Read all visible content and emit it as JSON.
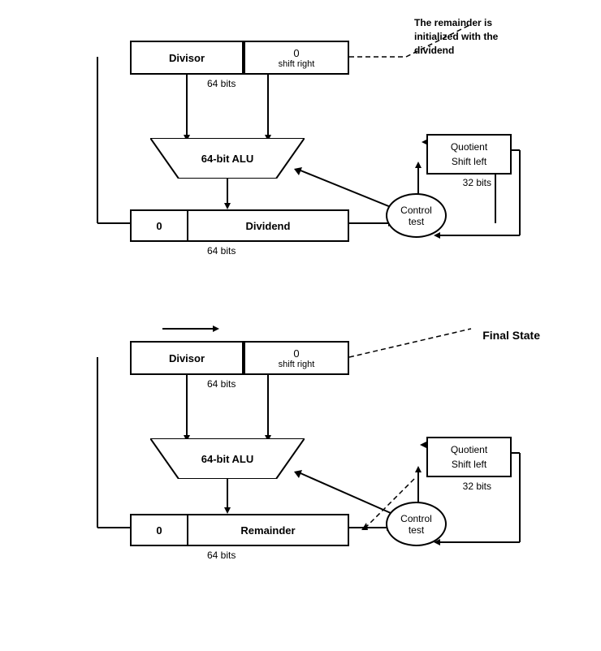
{
  "diagram1": {
    "annotation": "The remainder is\ninitialized with the\ndividend",
    "divisor_label": "Divisor",
    "divisor_zero": "0",
    "shift_right": "shift right",
    "bits_64_divisor": "64 bits",
    "alu_label": "64-bit ALU",
    "split_left": "0",
    "split_right": "Dividend",
    "bits_64_dividend": "64 bits",
    "quotient_line1": "Quotient",
    "quotient_line2": "Shift left",
    "bits_32": "32 bits",
    "control_line1": "Control",
    "control_line2": "test"
  },
  "diagram2": {
    "label_final_state": "Final State",
    "divisor_label": "Divisor",
    "divisor_zero": "0",
    "shift_right": "shift right",
    "bits_64_divisor": "64 bits",
    "alu_label": "64-bit ALU",
    "split_left": "0",
    "split_right": "Remainder",
    "bits_64_remainder": "64 bits",
    "quotient_line1": "Quotient",
    "quotient_line2": "Shift left",
    "bits_32": "32 bits",
    "control_line1": "Control",
    "control_line2": "test"
  }
}
